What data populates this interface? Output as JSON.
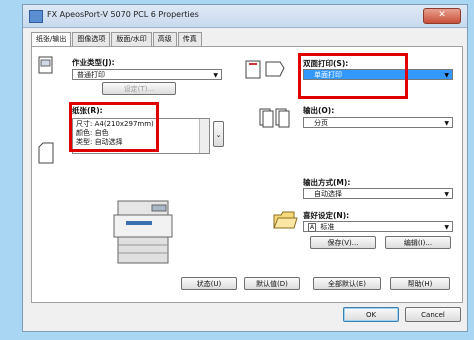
{
  "window": {
    "title": "FX ApeosPort-V 5070 PCL 6 Properties",
    "close_glyph": "✕"
  },
  "tabs": [
    "纸张/输出",
    "图像选项",
    "版面/水印",
    "高级",
    "传真"
  ],
  "job_type": {
    "label": "作业类型(J):",
    "value": "普通打印",
    "settings_button": "设定(T)..."
  },
  "duplex": {
    "label": "双面打印(S):",
    "value": "单面打印"
  },
  "paper": {
    "label": "纸张(R):",
    "lines": [
      "尺寸: A4(210x297mm)",
      "颜色: 自色",
      "类型: 自动选择"
    ]
  },
  "output": {
    "label": "输出(O):",
    "value": "分页"
  },
  "delivery": {
    "label": "输出方式(M):",
    "value": "自动选择"
  },
  "favorites": {
    "label": "喜好设定(N):",
    "value": "标准",
    "value_prefix": "A",
    "save_button": "保存(V)...",
    "edit_button": "编辑(I)..."
  },
  "bottom_buttons": [
    "状态(U)",
    "默认值(D)",
    "全部默认(E)",
    "帮助(H)"
  ],
  "dialog_buttons": {
    "ok": "OK",
    "cancel": "Cancel"
  },
  "colors": {
    "highlight": "#3399ff",
    "callout": "#e00000",
    "background": "#a8d6f3"
  }
}
